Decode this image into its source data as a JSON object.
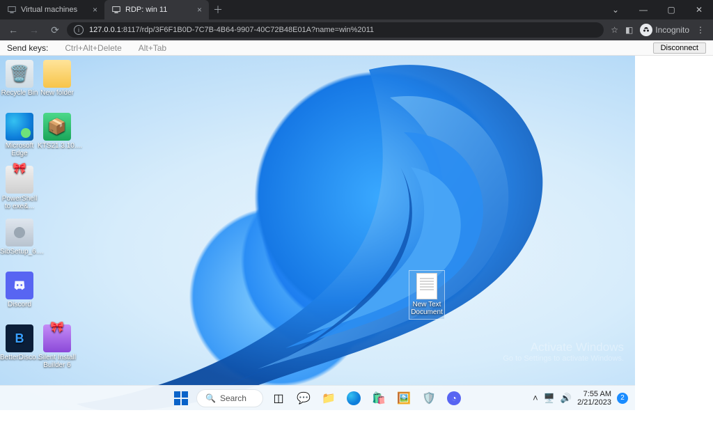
{
  "browser": {
    "tabs": [
      {
        "title": "Virtual machines",
        "active": false
      },
      {
        "title": "RDP: win 11",
        "active": true
      }
    ],
    "url_host": "127.0.0.1",
    "url_path": ":8117/rdp/3F6F1B0D-7C7B-4B64-9907-40C72B48E01A?name=win%2011",
    "incognito_label": "Incognito"
  },
  "rdp_toolbar": {
    "send_keys_label": "Send keys:",
    "ctrl_alt_del": "Ctrl+Alt+Delete",
    "alt_tab": "Alt+Tab",
    "disconnect": "Disconnect"
  },
  "desktop_icons": {
    "recycle_bin": "Recycle Bin",
    "new_folder": "New folder",
    "edge": "Microsoft Edge",
    "kts": "KTS21.3.10....",
    "powershell": "PowerShell to exe&...",
    "sibsetup": "SibSetup_6....",
    "discord": "Discord",
    "betterdiscord": "BetterDisco...",
    "sib": "Silent Install Builder 6"
  },
  "selected_doc": {
    "line1": "New Text",
    "line2": "Document"
  },
  "watermark": {
    "title": "Activate Windows",
    "sub": "Go to Settings to activate Windows."
  },
  "taskbar": {
    "search": "Search",
    "time": "7:55 AM",
    "date": "2/21/2023",
    "notif_count": "2"
  }
}
